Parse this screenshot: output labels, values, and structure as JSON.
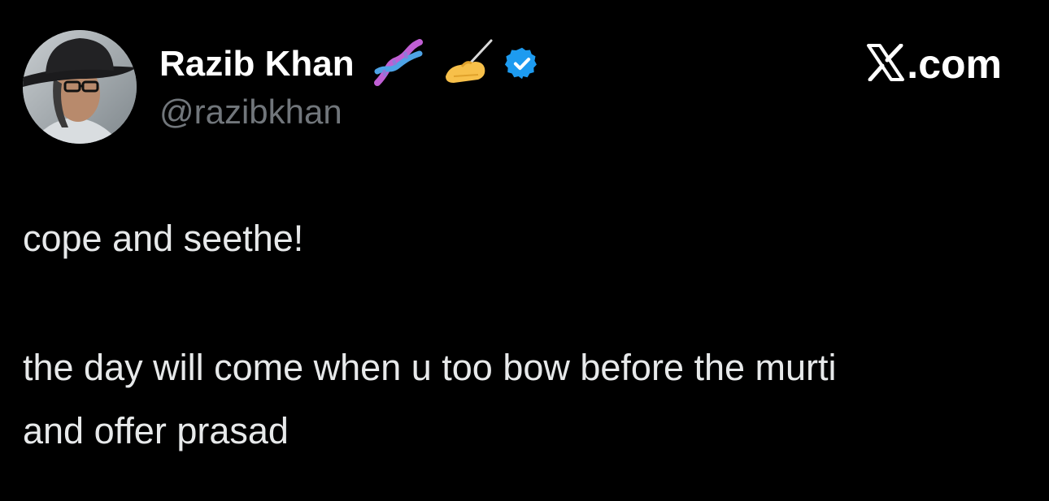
{
  "author": {
    "display_name": "Razib Khan",
    "handle": "@razibkhan",
    "badges": [
      "dna-emoji-icon",
      "writing-hand-emoji-icon",
      "verified-badge-icon"
    ],
    "verified_color": "#1d9bf0"
  },
  "source": {
    "label": ".com",
    "logo_icon": "x-logo-icon"
  },
  "tweet": {
    "lines": [
      "cope and seethe!",
      "the day will come when u too bow before the murti",
      "and offer prasad"
    ]
  },
  "colors": {
    "background": "#000000",
    "primary_text": "#e7e9ea",
    "secondary_text": "#71767b"
  }
}
